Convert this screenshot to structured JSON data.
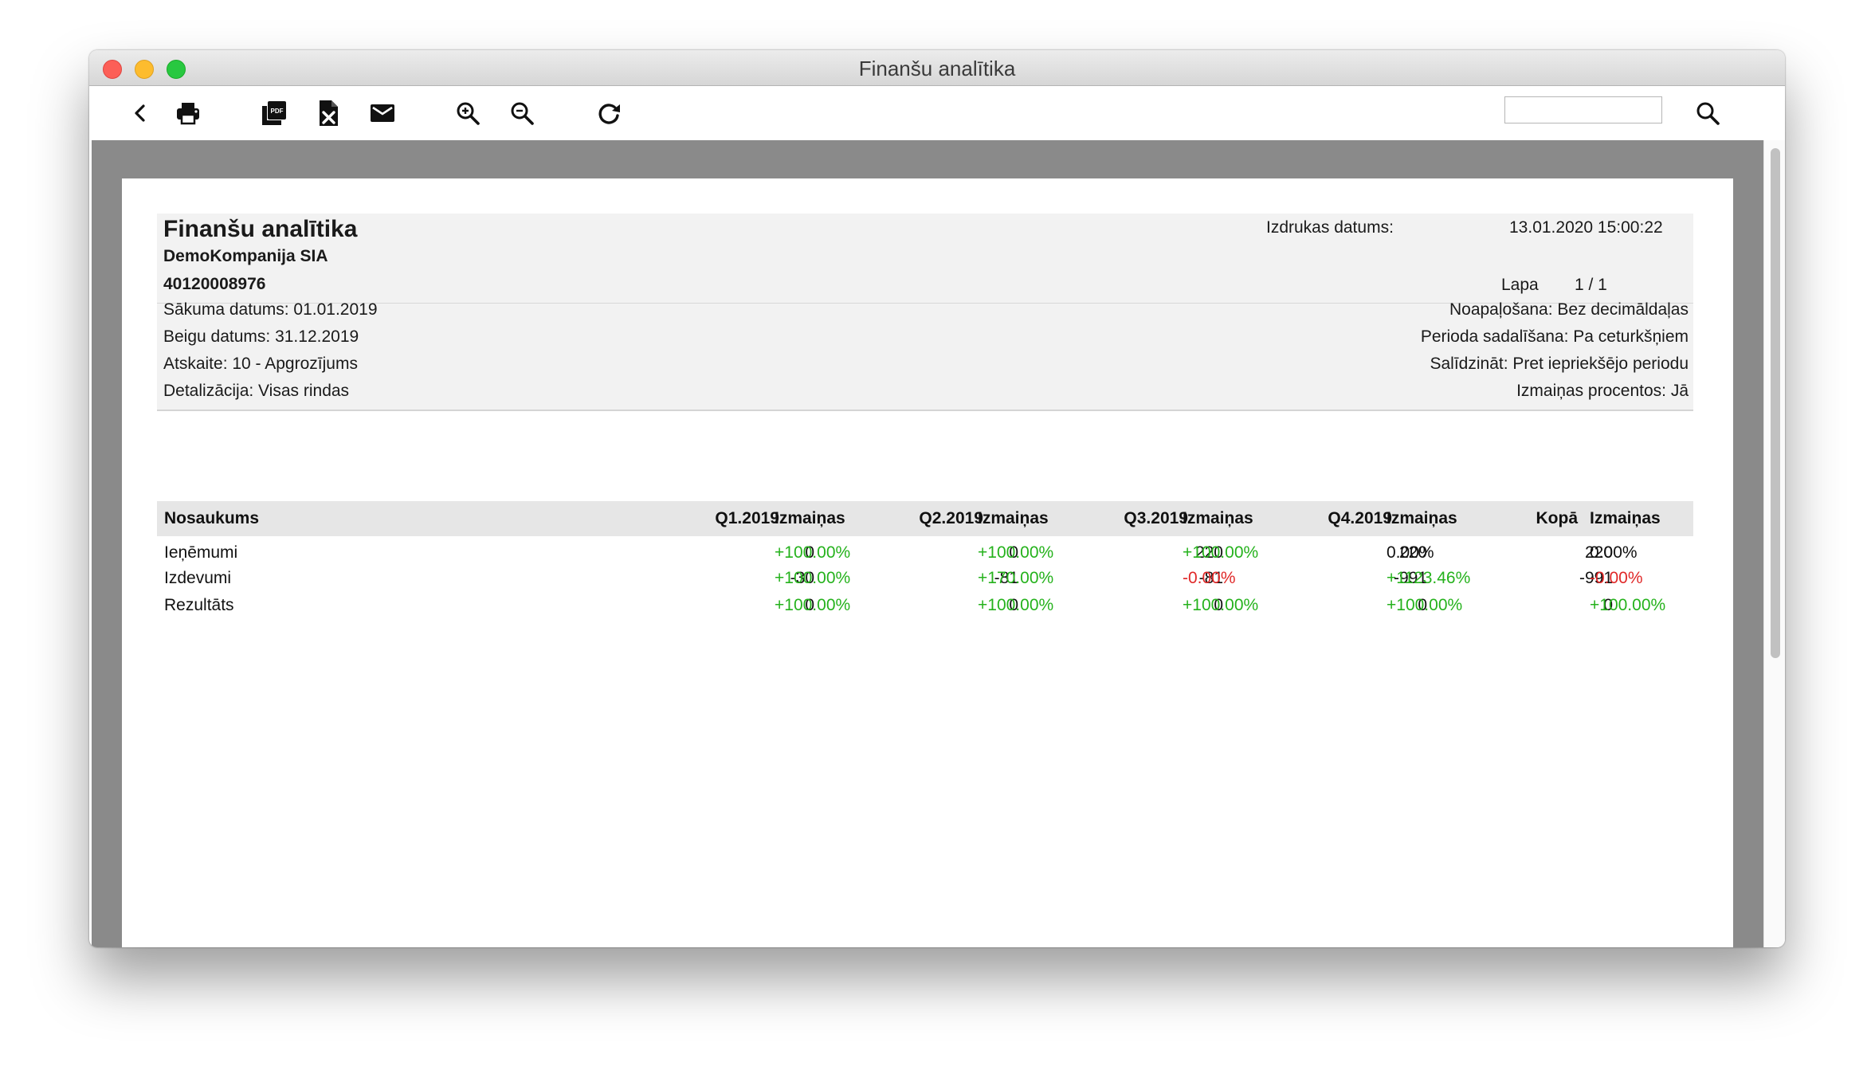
{
  "window": {
    "title": "Finanšu analītika"
  },
  "toolbar": {
    "icons": [
      "back-icon",
      "print-icon",
      "pdf-icon",
      "excel-icon",
      "mail-icon",
      "zoom-in-icon",
      "zoom-out-icon",
      "refresh-icon",
      "search-icon"
    ],
    "search_value": ""
  },
  "report": {
    "title": "Finanšu analītika",
    "company": "DemoKompanija SIA",
    "reg_no": "40120008976",
    "print_date_label": "Izdrukas datums:",
    "print_date": "13.01.2020 15:00:22",
    "page_label": "Lapa",
    "page_value": "1 / 1",
    "left_params": [
      "Sākuma datums: 01.01.2019",
      "Beigu datums: 31.12.2019",
      "Atskaite: 10 - Apgrozījums",
      "Detalizācija: Visas rindas"
    ],
    "right_params": [
      "Noapaļošana: Bez decimāldaļas",
      "Perioda sadalīšana: Pa ceturkšņiem",
      "Salīdzināt: Pret iepriekšējo periodu",
      "Izmaiņas procentos: Jā"
    ]
  },
  "table": {
    "headers": [
      "Nosaukums",
      "Q1.2019",
      "Izmaiņas",
      "Q2.2019",
      "Izmaiņas",
      "Q3.2019",
      "Izmaiņas",
      "Q4.2019",
      "Izmaiņas",
      "Kopā",
      "Izmaiņas"
    ],
    "rows": [
      {
        "name": "Ieņēmumi",
        "values": [
          "0",
          "+100.00%",
          "0",
          "+100.00%",
          "220",
          "+100.00%",
          "220",
          "0.00%",
          "220",
          "0.00%"
        ]
      },
      {
        "name": "Izdevumi",
        "values": [
          "-30",
          "+100.00%",
          "-81",
          "+170.00%",
          "-81",
          "-0.00%",
          "-991",
          "+1123.46%",
          "-991",
          "-0.00%"
        ]
      },
      {
        "name": "Rezultāts",
        "values": [
          "0",
          "+100.00%",
          "0",
          "+100.00%",
          "0",
          "+100.00%",
          "0",
          "+100.00%",
          "0",
          "+100.00%"
        ]
      }
    ],
    "colors": {
      "positive": "#25b21c",
      "negative": "#e02828"
    }
  }
}
